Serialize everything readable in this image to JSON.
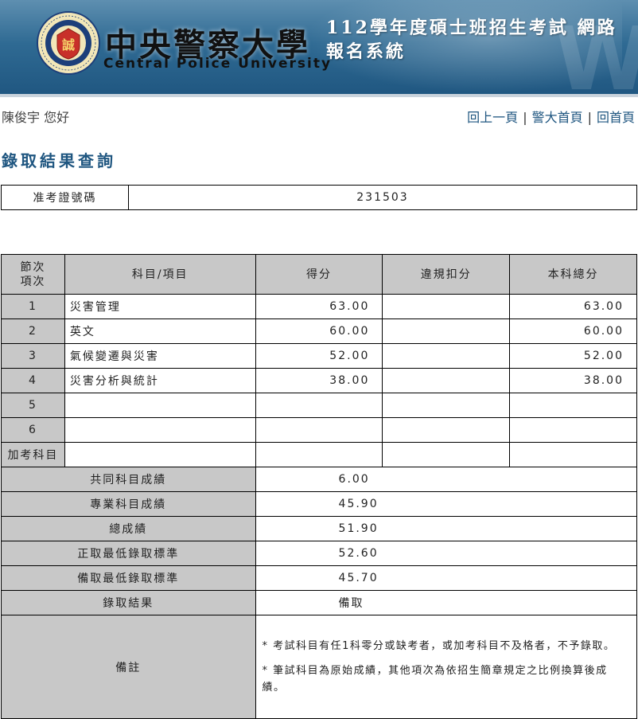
{
  "header": {
    "brand_cn": "中央警察大學",
    "brand_en": "Central Police University",
    "system_title_line1": "112學年度碩士班招生考試 網路",
    "system_title_line2": "報名系統",
    "logo_text": "誠"
  },
  "greeting": "陳俊宇 您好",
  "nav": {
    "back": "回上一頁",
    "cpu_home": "警大首頁",
    "home": "回首頁",
    "separator": "|"
  },
  "page_title": "錄取結果查詢",
  "ticket": {
    "label": "准考證號碼",
    "value": "231503"
  },
  "score_table": {
    "headers": {
      "seq": "節次\n項次",
      "subject": "科目/項目",
      "score": "得分",
      "penalty": "違規扣分",
      "total": "本科總分"
    },
    "rows": [
      {
        "seq": "1",
        "subject": "災害管理",
        "score": "63.00",
        "penalty": "",
        "total": "63.00"
      },
      {
        "seq": "2",
        "subject": "英文",
        "score": "60.00",
        "penalty": "",
        "total": "60.00"
      },
      {
        "seq": "3",
        "subject": "氣候變遷與災害",
        "score": "52.00",
        "penalty": "",
        "total": "52.00"
      },
      {
        "seq": "4",
        "subject": "災害分析與統計",
        "score": "38.00",
        "penalty": "",
        "total": "38.00"
      },
      {
        "seq": "5",
        "subject": "",
        "score": "",
        "penalty": "",
        "total": ""
      },
      {
        "seq": "6",
        "subject": "",
        "score": "",
        "penalty": "",
        "total": ""
      },
      {
        "seq": "加考科目",
        "subject": "",
        "score": "",
        "penalty": "",
        "total": ""
      }
    ],
    "summary": [
      {
        "label": "共同科目成績",
        "value": "6.00"
      },
      {
        "label": "專業科目成績",
        "value": "45.90"
      },
      {
        "label": "總成績",
        "value": "51.90"
      },
      {
        "label": "正取最低錄取標準",
        "value": "52.60"
      },
      {
        "label": "備取最低錄取標準",
        "value": "45.70"
      },
      {
        "label": "錄取結果",
        "value": "備取"
      }
    ],
    "notes_label": "備註",
    "notes": [
      "* 考試科目有任1科零分或缺考者，或加考科目不及格者，不予錄取。",
      "* 筆試科目為原始成績，其他項次為依招生簡章規定之比例換算後成績。"
    ]
  }
}
